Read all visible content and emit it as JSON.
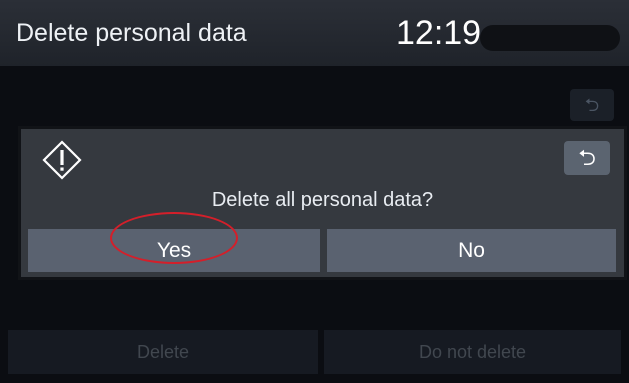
{
  "header": {
    "title": "Delete personal data",
    "clock": "12:19"
  },
  "dialog": {
    "message": "Delete all personal data?",
    "yes_label": "Yes",
    "no_label": "No",
    "back_icon": "return-arrow-icon",
    "warning_icon": "warning-diamond-icon"
  },
  "background": {
    "delete_label": "Delete",
    "do_not_delete_label": "Do not delete"
  },
  "colors": {
    "highlight": "#d41f2a",
    "dialog_button": "#5a6270"
  }
}
